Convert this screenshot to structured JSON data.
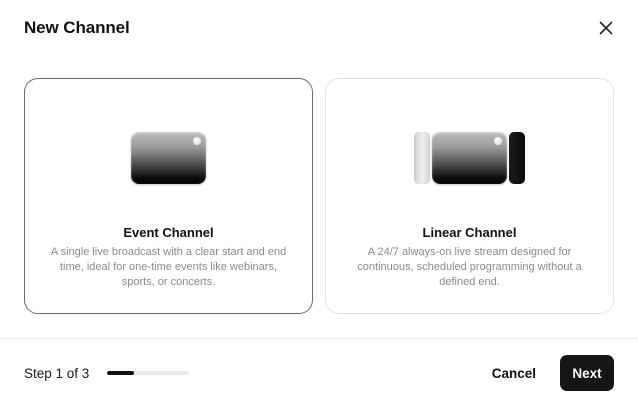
{
  "dialog": {
    "title": "New Channel",
    "close_icon": "close-icon"
  },
  "cards": [
    {
      "title": "Event Channel",
      "description": "A single live broadcast with a clear start and end time, ideal for one-time events like webinars, sports, or concerts.",
      "selected": true,
      "illustration": "single-screen"
    },
    {
      "title": "Linear Channel",
      "description": "A 24/7 always-on live stream designed for continuous, scheduled programming without a defined end.",
      "selected": false,
      "illustration": "screen-carousel"
    }
  ],
  "footer": {
    "step_text": "Step 1 of 3",
    "progress_fraction": 0.33,
    "cancel_label": "Cancel",
    "next_label": "Next"
  },
  "colors": {
    "primary_button": "#151515",
    "selected_border": "#6b6b6b",
    "muted_text": "#8a8a8a"
  }
}
